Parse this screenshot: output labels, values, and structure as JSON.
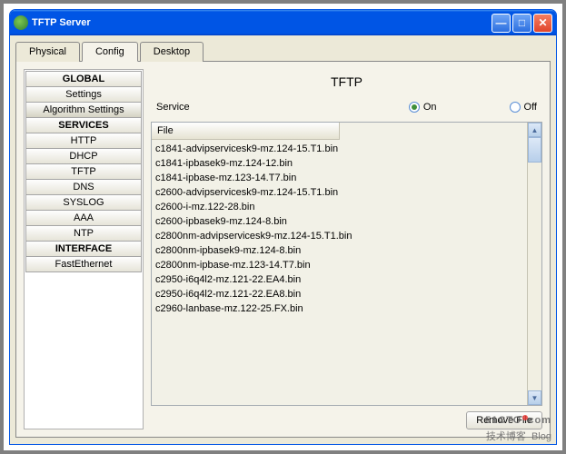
{
  "window": {
    "title": "TFTP Server"
  },
  "tabs": [
    {
      "label": "Physical",
      "active": false
    },
    {
      "label": "Config",
      "active": true
    },
    {
      "label": "Desktop",
      "active": false
    }
  ],
  "sidebar": {
    "sections": [
      {
        "head": "GLOBAL",
        "items": [
          "Settings",
          "Algorithm Settings"
        ]
      },
      {
        "head": "SERVICES",
        "items": [
          "HTTP",
          "DHCP",
          "TFTP",
          "DNS",
          "SYSLOG",
          "AAA",
          "NTP"
        ]
      },
      {
        "head": "INTERFACE",
        "items": [
          "FastEthernet"
        ]
      }
    ],
    "selected": "Algorithm Settings"
  },
  "main": {
    "heading": "TFTP",
    "service_label": "Service",
    "radio_on": "On",
    "radio_off": "Off",
    "service_state": "on",
    "column_header": "File",
    "files": [
      "c1841-advipservicesk9-mz.124-15.T1.bin",
      "c1841-ipbasek9-mz.124-12.bin",
      "c1841-ipbase-mz.123-14.T7.bin",
      "c2600-advipservicesk9-mz.124-15.T1.bin",
      "c2600-i-mz.122-28.bin",
      "c2600-ipbasek9-mz.124-8.bin",
      "c2800nm-advipservicesk9-mz.124-15.T1.bin",
      "c2800nm-ipbasek9-mz.124-8.bin",
      "c2800nm-ipbase-mz.123-14.T7.bin",
      "c2950-i6q4l2-mz.121-22.EA4.bin",
      "c2950-i6q4l2-mz.121-22.EA8.bin",
      "c2960-lanbase-mz.122-25.FX.bin"
    ],
    "remove_button": "Remove File"
  },
  "watermark": {
    "line1": "51CTO",
    "suffix": "com",
    "line2": "技术博客",
    "blog": "Blog"
  }
}
